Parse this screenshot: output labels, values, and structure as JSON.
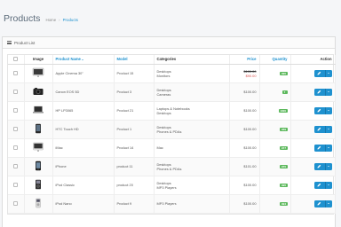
{
  "header": {
    "title": "Products",
    "breadcrumb": [
      {
        "label": "Home",
        "active": false
      },
      {
        "label": "Products",
        "active": true
      }
    ]
  },
  "panel": {
    "heading": "Product List",
    "icon": "list-icon"
  },
  "table": {
    "columns": {
      "image": "Image",
      "name": "Product Name",
      "model": "Model",
      "category": "Categories",
      "price": "Price",
      "quantity": "Quantity",
      "action": "Action"
    },
    "rows": [
      {
        "image": "apple-cinema-display",
        "name": "Apple Cinema 30\"",
        "model": "Product 15",
        "categories": [
          "Desktops",
          "Monitors"
        ],
        "price": "$100.00",
        "special": "$90.00",
        "quantity": "990",
        "status": "success"
      },
      {
        "image": "canon-camera",
        "name": "Canon EOS 5D",
        "model": "Product 3",
        "categories": [
          "Desktops",
          "Cameras"
        ],
        "price": "$100.00",
        "special": null,
        "quantity": "7",
        "status": "success"
      },
      {
        "image": "laptop",
        "name": "HP LP3065",
        "model": "Product 21",
        "categories": [
          "Laptops & Notebooks",
          "Desktops"
        ],
        "price": "$100.00",
        "special": null,
        "quantity": "1000",
        "status": "success"
      },
      {
        "image": "phone",
        "name": "HTC Touch HD",
        "model": "Product 1",
        "categories": [
          "Desktops",
          "Phones & PDAs"
        ],
        "price": "$100.00",
        "special": null,
        "quantity": "939",
        "status": "success"
      },
      {
        "image": "imac",
        "name": "iMac",
        "model": "Product 14",
        "categories": [
          "Mac"
        ],
        "price": "$100.00",
        "special": null,
        "quantity": "977",
        "status": "success"
      },
      {
        "image": "iphone",
        "name": "iPhone",
        "model": "product 11",
        "categories": [
          "Desktops",
          "Phones & PDAs"
        ],
        "price": "$101.00",
        "special": null,
        "quantity": "970",
        "status": "success"
      },
      {
        "image": "ipod-classic",
        "name": "iPod Classic",
        "model": "product 20",
        "categories": [
          "Desktops",
          "MP3 Players"
        ],
        "price": "$100.00",
        "special": null,
        "quantity": "995",
        "status": "success"
      },
      {
        "image": "ipod-nano",
        "name": "iPod Nano",
        "model": "Product 9",
        "categories": [
          "MP3 Players"
        ],
        "price": "$100.00",
        "special": null,
        "quantity": "994",
        "status": "success"
      }
    ]
  },
  "colors": {
    "accent": "#1e91cf",
    "success": "#5cb85c",
    "special_price": "#d9534f"
  }
}
